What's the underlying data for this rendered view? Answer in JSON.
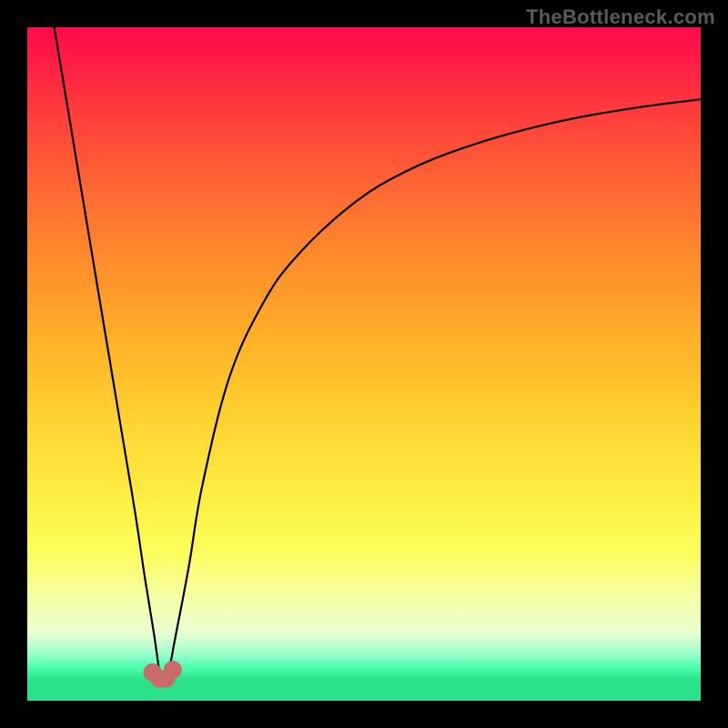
{
  "watermark_text": "TheBottleneck.com",
  "curve_color": "#000000",
  "curve_width": 2.2,
  "dot_color": "#c96b6b",
  "dot_radius": 10,
  "chart_data": {
    "type": "line",
    "title": "",
    "xlabel": "",
    "ylabel": "",
    "xlim": [
      0,
      100
    ],
    "ylim": [
      0,
      100
    ],
    "series": [
      {
        "name": "left-branch",
        "x": [
          4,
          6,
          8,
          10,
          12,
          14,
          16,
          17.5,
          18.8,
          19.6,
          20.0
        ],
        "values": [
          100,
          88,
          76,
          64,
          52,
          40,
          28,
          18,
          10,
          4.5,
          3.0
        ]
      },
      {
        "name": "right-branch",
        "x": [
          20.0,
          21.0,
          22.0,
          24,
          26,
          30,
          35,
          40,
          48,
          56,
          66,
          78,
          90,
          100
        ],
        "values": [
          3.0,
          4.5,
          9.5,
          20,
          32,
          48,
          59,
          66,
          73.5,
          78.5,
          82.5,
          85.8,
          88.0,
          89.3
        ]
      }
    ],
    "markers": [
      {
        "x": 18.6,
        "y": 4.2
      },
      {
        "x": 19.6,
        "y": 3.3
      },
      {
        "x": 20.6,
        "y": 3.3
      },
      {
        "x": 21.6,
        "y": 4.6
      }
    ],
    "annotations": []
  }
}
